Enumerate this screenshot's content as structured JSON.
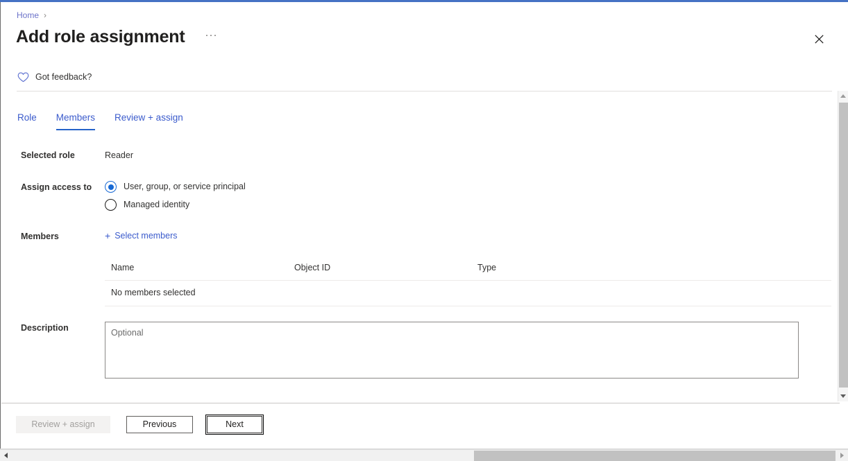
{
  "window": {
    "accent_color": "#4572c4"
  },
  "header": {
    "breadcrumb": {
      "home_label": "Home",
      "separator": "›"
    },
    "title": "Add role assignment",
    "ellipsis_label": "···",
    "close_icon": "close-icon",
    "feedback": {
      "icon": "heart-icon",
      "label": "Got feedback?"
    }
  },
  "tabs": [
    {
      "label": "Role",
      "active": false
    },
    {
      "label": "Members",
      "active": true
    },
    {
      "label": "Review + assign",
      "active": false
    }
  ],
  "form": {
    "selected_role": {
      "label": "Selected role",
      "value": "Reader"
    },
    "assign_access_to": {
      "label": "Assign access to",
      "options": [
        {
          "label": "User, group, or service principal",
          "selected": true
        },
        {
          "label": "Managed identity",
          "selected": false
        }
      ]
    },
    "members": {
      "label": "Members",
      "select_members_link": "Select members",
      "plus_icon": "plus-icon",
      "table": {
        "columns": [
          "Name",
          "Object ID",
          "Type"
        ],
        "empty_message": "No members selected",
        "rows": []
      }
    },
    "description": {
      "label": "Description",
      "placeholder": "Optional",
      "value": ""
    }
  },
  "footer": {
    "review_assign_label": "Review + assign",
    "previous_label": "Previous",
    "next_label": "Next"
  },
  "colors": {
    "link_blue": "#3b5bcc",
    "tab_active_underline": "#2563c9",
    "radio_selected": "#1668d4",
    "breadcrumb_link": "#6b72c9"
  }
}
